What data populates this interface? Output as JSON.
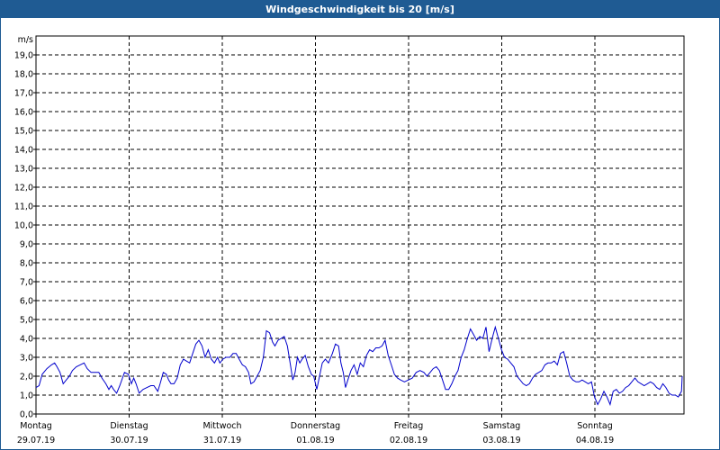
{
  "window": {
    "title": "Windgeschwindigkeit bis 20 [m/s]"
  },
  "colors": {
    "titlebar": "#1f5b93",
    "series": "#0000cc",
    "grid": "#000000"
  },
  "chart_data": {
    "type": "line",
    "title": "Windgeschwindigkeit bis 20 [m/s]",
    "ylabel": "m/s",
    "xlabel": "",
    "ylim": [
      0,
      20
    ],
    "yticks": [
      "0,0",
      "1,0",
      "2,0",
      "3,0",
      "4,0",
      "5,0",
      "6,0",
      "7,0",
      "8,0",
      "9,0",
      "10,0",
      "11,0",
      "12,0",
      "13,0",
      "14,0",
      "15,0",
      "16,0",
      "17,0",
      "18,0",
      "19,0"
    ],
    "grid": true,
    "days": [
      {
        "weekday": "Montag",
        "date": "29.07.19"
      },
      {
        "weekday": "Dienstag",
        "date": "30.07.19"
      },
      {
        "weekday": "Mittwoch",
        "date": "31.07.19"
      },
      {
        "weekday": "Donnerstag",
        "date": "01.08.19"
      },
      {
        "weekday": "Freitag",
        "date": "02.08.19"
      },
      {
        "weekday": "Samstag",
        "date": "03.08.19"
      },
      {
        "weekday": "Sonntag",
        "date": "04.08.19"
      }
    ],
    "xlim": [
      0,
      7
    ],
    "series": [
      {
        "name": "",
        "points": [
          [
            0.0,
            1.4
          ],
          [
            0.04,
            1.5
          ],
          [
            0.08,
            2.1
          ],
          [
            0.14,
            2.4
          ],
          [
            0.2,
            2.6
          ],
          [
            0.24,
            2.7
          ],
          [
            0.27,
            2.5
          ],
          [
            0.31,
            2.2
          ],
          [
            0.35,
            1.6
          ],
          [
            0.39,
            1.8
          ],
          [
            0.43,
            2.0
          ],
          [
            0.47,
            2.3
          ],
          [
            0.52,
            2.5
          ],
          [
            0.57,
            2.6
          ],
          [
            0.62,
            2.7
          ],
          [
            0.66,
            2.4
          ],
          [
            0.71,
            2.2
          ],
          [
            0.76,
            2.2
          ],
          [
            0.81,
            2.2
          ],
          [
            0.85,
            1.9
          ],
          [
            0.9,
            1.6
          ],
          [
            0.94,
            1.3
          ],
          [
            0.97,
            1.5
          ],
          [
            1.0,
            1.3
          ],
          [
            1.04,
            1.1
          ],
          [
            1.08,
            1.5
          ],
          [
            1.14,
            2.2
          ],
          [
            1.19,
            2.1
          ],
          [
            1.23,
            1.6
          ],
          [
            1.26,
            1.9
          ],
          [
            1.29,
            1.6
          ],
          [
            1.33,
            1.1
          ],
          [
            1.38,
            1.3
          ],
          [
            1.43,
            1.4
          ],
          [
            1.48,
            1.5
          ],
          [
            1.52,
            1.5
          ],
          [
            1.57,
            1.2
          ],
          [
            1.6,
            1.6
          ],
          [
            1.64,
            2.2
          ],
          [
            1.68,
            2.1
          ],
          [
            1.71,
            1.8
          ],
          [
            1.74,
            1.6
          ],
          [
            1.78,
            1.6
          ],
          [
            1.82,
            1.9
          ],
          [
            1.86,
            2.6
          ],
          [
            1.9,
            2.9
          ],
          [
            1.94,
            2.8
          ],
          [
            1.98,
            2.7
          ],
          [
            2.02,
            3.2
          ],
          [
            2.06,
            3.7
          ],
          [
            2.1,
            3.9
          ],
          [
            2.14,
            3.6
          ],
          [
            2.18,
            3.0
          ],
          [
            2.22,
            3.4
          ],
          [
            2.26,
            2.9
          ],
          [
            2.3,
            2.7
          ],
          [
            2.34,
            3.0
          ],
          [
            2.37,
            2.7
          ],
          [
            2.41,
            2.9
          ],
          [
            2.45,
            3.0
          ],
          [
            2.5,
            3.0
          ],
          [
            2.54,
            3.2
          ],
          [
            2.58,
            3.2
          ],
          [
            2.62,
            2.9
          ],
          [
            2.66,
            2.6
          ],
          [
            2.7,
            2.5
          ],
          [
            2.74,
            2.2
          ],
          [
            2.77,
            1.6
          ],
          [
            2.81,
            1.7
          ],
          [
            2.85,
            2.0
          ],
          [
            2.89,
            2.3
          ],
          [
            2.93,
            3.0
          ],
          [
            2.97,
            4.4
          ],
          [
            3.01,
            4.3
          ],
          [
            3.05,
            3.8
          ],
          [
            3.08,
            3.6
          ],
          [
            3.12,
            3.9
          ],
          [
            3.16,
            4.0
          ],
          [
            3.2,
            4.1
          ],
          [
            3.24,
            3.6
          ],
          [
            3.28,
            2.6
          ],
          [
            3.31,
            1.8
          ],
          [
            3.34,
            2.2
          ],
          [
            3.37,
            3.0
          ],
          [
            3.4,
            2.7
          ],
          [
            3.43,
            2.9
          ],
          [
            3.47,
            3.1
          ],
          [
            3.51,
            2.5
          ],
          [
            3.55,
            2.1
          ],
          [
            3.58,
            2.0
          ],
          [
            3.62,
            1.3
          ],
          [
            3.65,
            1.9
          ],
          [
            3.69,
            2.7
          ],
          [
            3.73,
            2.9
          ],
          [
            3.77,
            2.7
          ],
          [
            3.82,
            3.2
          ],
          [
            3.86,
            3.7
          ],
          [
            3.9,
            3.6
          ],
          [
            3.93,
            2.7
          ],
          [
            3.96,
            2.2
          ],
          [
            3.99,
            1.4
          ],
          [
            4.02,
            1.8
          ],
          [
            4.06,
            2.3
          ],
          [
            4.1,
            2.6
          ],
          [
            4.14,
            2.1
          ],
          [
            4.18,
            2.7
          ],
          [
            4.22,
            2.5
          ],
          [
            4.26,
            3.1
          ],
          [
            4.3,
            3.4
          ],
          [
            4.34,
            3.3
          ],
          [
            4.38,
            3.5
          ],
          [
            4.42,
            3.5
          ],
          [
            4.46,
            3.6
          ],
          [
            4.5,
            3.9
          ],
          [
            4.54,
            3.1
          ],
          [
            4.58,
            2.6
          ],
          [
            4.62,
            2.1
          ],
          [
            4.66,
            1.9
          ],
          [
            4.7,
            1.8
          ],
          [
            4.75,
            1.7
          ],
          [
            4.8,
            1.8
          ],
          [
            4.85,
            1.9
          ],
          [
            4.9,
            2.2
          ],
          [
            4.95,
            2.3
          ],
          [
            5.0,
            2.2
          ],
          [
            5.04,
            2.0
          ],
          [
            5.08,
            2.2
          ],
          [
            5.12,
            2.4
          ],
          [
            5.16,
            2.5
          ],
          [
            5.2,
            2.3
          ],
          [
            5.24,
            1.8
          ],
          [
            5.28,
            1.3
          ],
          [
            5.32,
            1.3
          ],
          [
            5.36,
            1.6
          ],
          [
            5.4,
            2.0
          ],
          [
            5.44,
            2.3
          ],
          [
            5.48,
            3.0
          ],
          [
            5.52,
            3.4
          ],
          [
            5.56,
            4.0
          ],
          [
            5.6,
            4.5
          ],
          [
            5.64,
            4.2
          ],
          [
            5.68,
            3.9
          ],
          [
            5.72,
            4.1
          ],
          [
            5.76,
            4.0
          ],
          [
            5.8,
            4.6
          ],
          [
            5.84,
            3.3
          ],
          [
            5.88,
            4.0
          ],
          [
            5.92,
            4.6
          ],
          [
            5.96,
            4.0
          ],
          [
            6.0,
            3.4
          ],
          [
            6.04,
            3.0
          ],
          [
            6.08,
            2.9
          ],
          [
            6.12,
            2.7
          ],
          [
            6.16,
            2.5
          ],
          [
            6.2,
            2.0
          ],
          [
            6.24,
            1.8
          ],
          [
            6.28,
            1.6
          ],
          [
            6.32,
            1.5
          ],
          [
            6.36,
            1.6
          ],
          [
            6.4,
            1.9
          ],
          [
            6.44,
            2.1
          ],
          [
            6.48,
            2.2
          ],
          [
            6.52,
            2.3
          ],
          [
            6.56,
            2.6
          ],
          [
            6.6,
            2.7
          ],
          [
            6.64,
            2.7
          ],
          [
            6.68,
            2.8
          ],
          [
            6.72,
            2.6
          ],
          [
            6.76,
            3.2
          ],
          [
            6.8,
            3.3
          ],
          [
            6.84,
            2.7
          ],
          [
            6.88,
            2.0
          ],
          [
            6.92,
            1.8
          ],
          [
            6.96,
            1.7
          ],
          [
            7.0,
            1.7
          ],
          [
            7.04,
            1.8
          ],
          [
            7.08,
            1.7
          ],
          [
            7.12,
            1.6
          ],
          [
            7.16,
            1.7
          ],
          [
            7.2,
            0.9
          ],
          [
            7.24,
            0.5
          ],
          [
            7.28,
            0.8
          ],
          [
            7.32,
            1.2
          ],
          [
            7.36,
            0.9
          ],
          [
            7.4,
            0.5
          ],
          [
            7.44,
            1.2
          ],
          [
            7.48,
            1.3
          ],
          [
            7.52,
            1.1
          ],
          [
            7.56,
            1.2
          ],
          [
            7.6,
            1.4
          ],
          [
            7.64,
            1.5
          ],
          [
            7.68,
            1.7
          ],
          [
            7.72,
            1.9
          ],
          [
            7.76,
            1.7
          ],
          [
            7.8,
            1.6
          ],
          [
            7.84,
            1.5
          ],
          [
            7.88,
            1.6
          ],
          [
            7.92,
            1.7
          ],
          [
            7.96,
            1.6
          ],
          [
            8.0,
            1.4
          ],
          [
            8.04,
            1.3
          ],
          [
            8.08,
            1.6
          ],
          [
            8.12,
            1.4
          ],
          [
            8.16,
            1.1
          ],
          [
            8.2,
            1.0
          ],
          [
            8.24,
            1.0
          ],
          [
            8.28,
            0.9
          ],
          [
            8.32,
            1.2
          ],
          [
            8.36,
            2.0
          ]
        ]
      }
    ]
  }
}
